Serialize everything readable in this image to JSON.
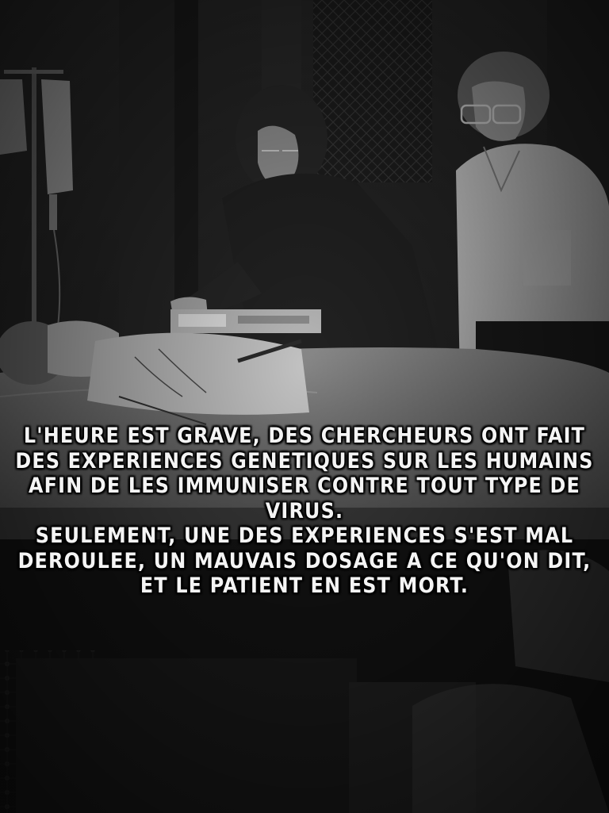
{
  "caption": {
    "lines": [
      "L'HEURE EST GRAVE, DES CHERCHEURS ONT FAIT",
      "DES EXPERIENCES GENETIQUES SUR LES HUMAINS",
      "AFIN DE LES IMMUNISER CONTRE TOUT TYPE DE",
      "VIRUS.",
      "SEULEMENT, UNE DES EXPERIENCES S'EST MAL",
      "DEROULEE, UN MAUVAIS DOSAGE A CE QU'ON DIT,",
      "ET LE PATIENT EN EST MORT."
    ]
  },
  "colors": {
    "caption_text": "#f4f4f4",
    "caption_outline": "#000000",
    "background": "#111111"
  }
}
